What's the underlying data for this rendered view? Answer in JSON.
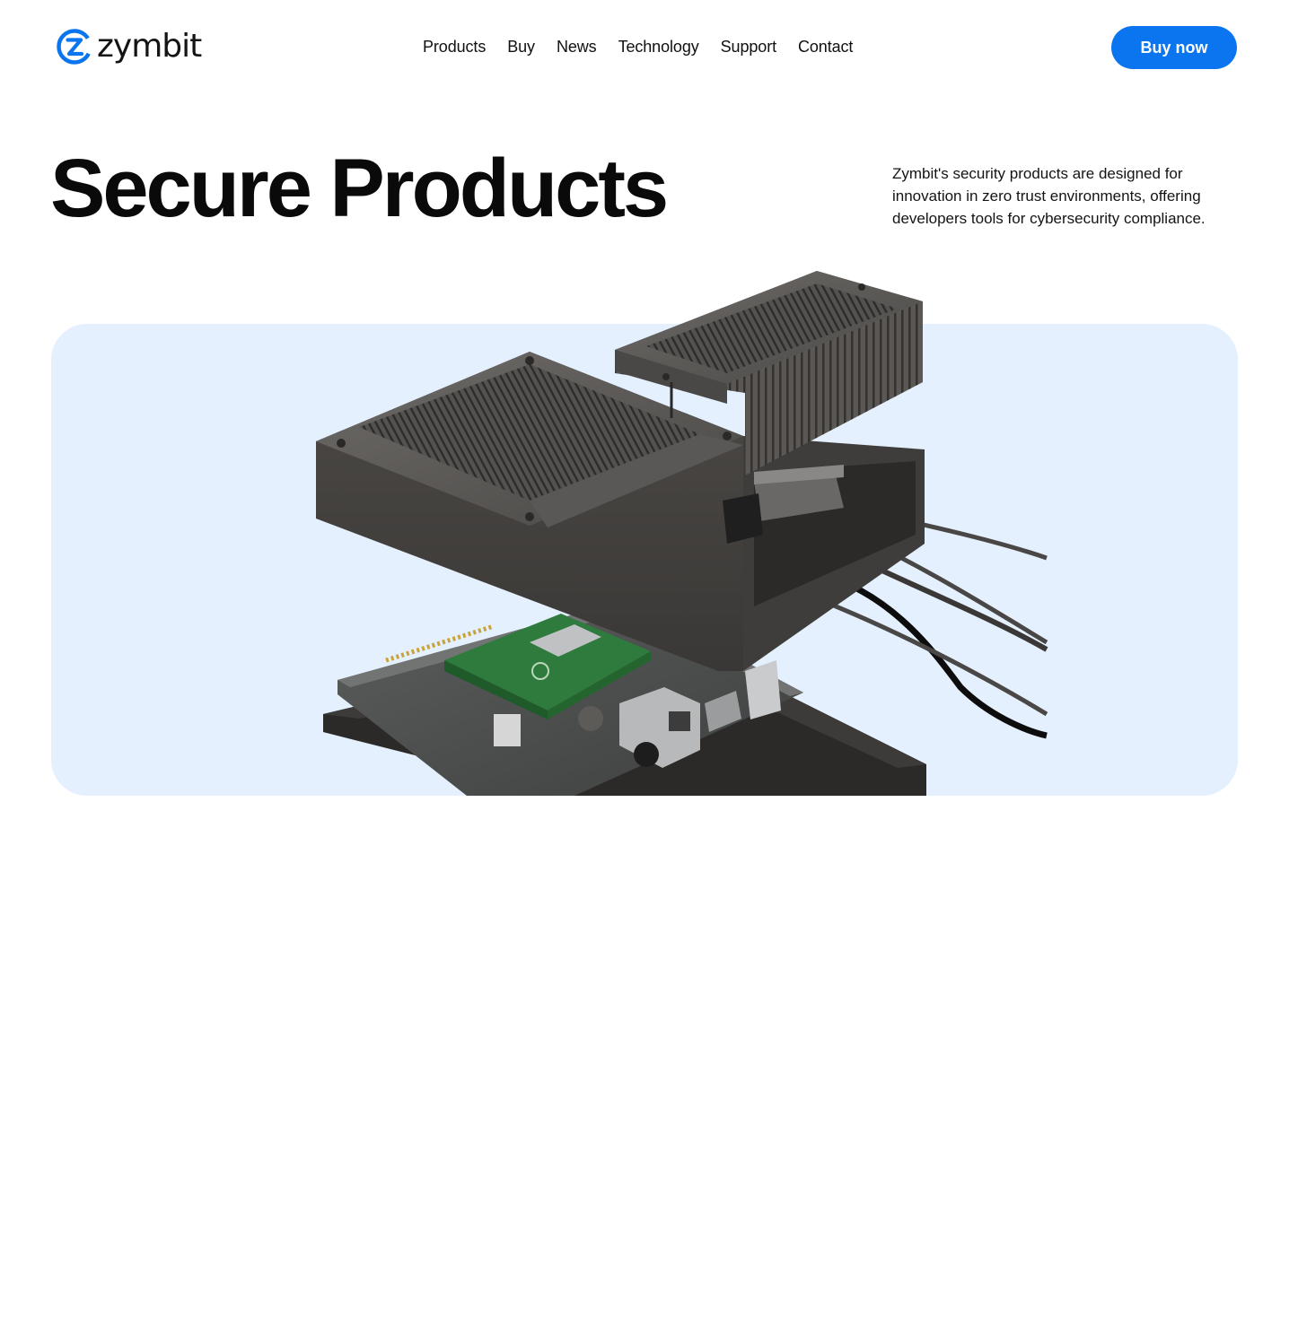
{
  "brand": {
    "name": "zymbit",
    "logo_icon": "zymbit-z-circle-logo",
    "accent_color": "#0b75f0",
    "card_color": "#e4f0fd"
  },
  "nav": {
    "items": [
      "Products",
      "Buy",
      "News",
      "Technology",
      "Support",
      "Contact"
    ]
  },
  "header": {
    "cta_label": "Buy now"
  },
  "hero": {
    "title": "Secure Products",
    "description": "Zymbit's security products are designed for innovation in zero trust environments, offering developers tools for cybersecurity compliance.",
    "image": "exploded-secure-edge-node-render"
  }
}
